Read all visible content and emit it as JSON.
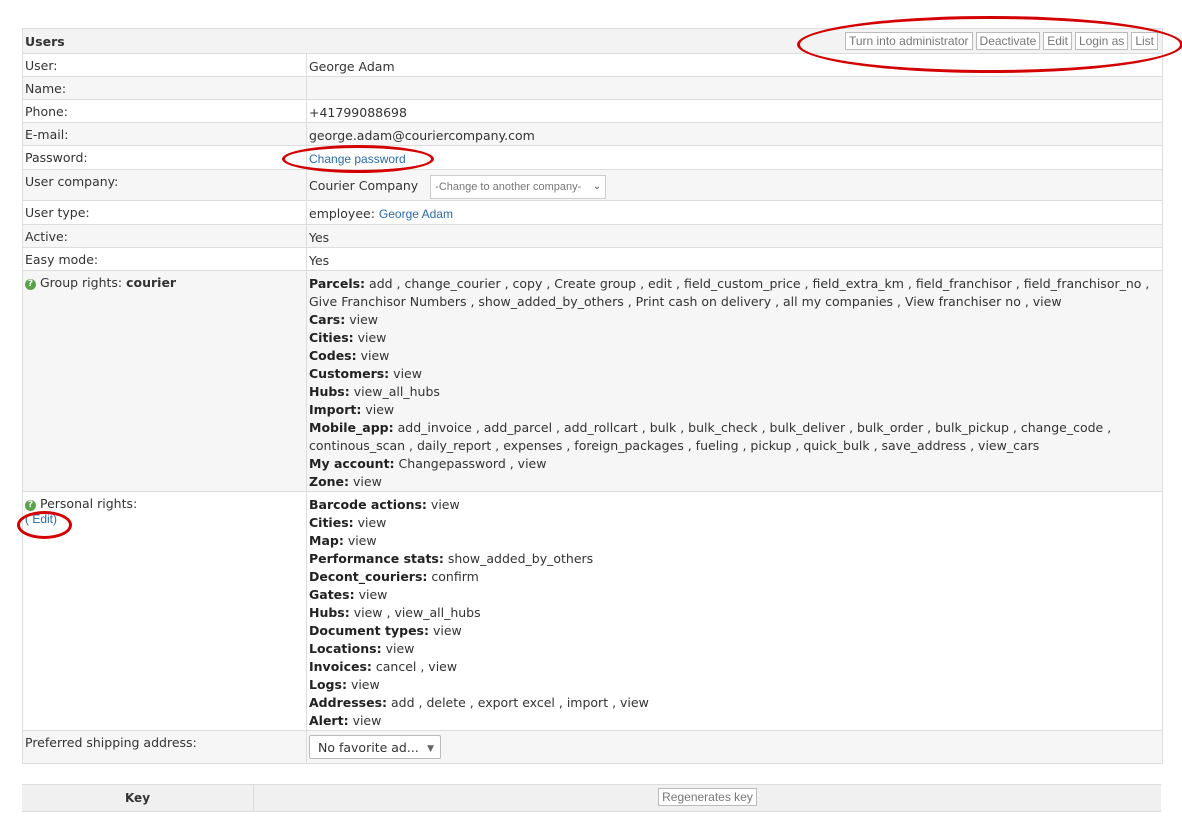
{
  "header": {
    "title": "Users",
    "buttons": [
      "Turn into administrator",
      "Deactivate",
      "Edit",
      "Login as",
      "List"
    ]
  },
  "fields": {
    "user": {
      "label": "User:",
      "value": "George Adam"
    },
    "name": {
      "label": "Name:",
      "value": ""
    },
    "phone": {
      "label": "Phone:",
      "value": "+41799088698"
    },
    "email": {
      "label": "E-mail:",
      "value": "george.adam@couriercompany.com"
    },
    "password": {
      "label": "Password:",
      "link": "Change password"
    },
    "company": {
      "label": "User company:",
      "value": "Courier Company",
      "select_placeholder": "-Change to another company-"
    },
    "user_type": {
      "label": "User type:",
      "prefix": "employee:",
      "link": "George Adam"
    },
    "active": {
      "label": "Active:",
      "value": "Yes"
    },
    "easy_mode": {
      "label": "Easy mode:",
      "value": "Yes"
    }
  },
  "group_rights": {
    "label": "Group rights:",
    "group": "courier",
    "perms": [
      {
        "name": "Parcels:",
        "values": "add , change_courier , copy , Create group , edit , field_custom_price , field_extra_km , field_franchisor , field_franchisor_no , Give Franchisor Numbers , show_added_by_others , Print cash on delivery , all my companies , View franchiser no , view"
      },
      {
        "name": "Cars:",
        "values": "view"
      },
      {
        "name": "Cities:",
        "values": "view"
      },
      {
        "name": "Codes:",
        "values": "view"
      },
      {
        "name": "Customers:",
        "values": "view"
      },
      {
        "name": "Hubs:",
        "values": "view_all_hubs"
      },
      {
        "name": "Import:",
        "values": "view"
      },
      {
        "name": "Mobile_app:",
        "values": "add_invoice , add_parcel , add_rollcart , bulk , bulk_check , bulk_deliver , bulk_order , bulk_pickup , change_code , continous_scan , daily_report , expenses , foreign_packages , fueling , pickup , quick_bulk , save_address , view_cars"
      },
      {
        "name": "My account:",
        "values": "Changepassword , view"
      },
      {
        "name": "Zone:",
        "values": "view"
      }
    ]
  },
  "personal_rights": {
    "label": "Personal rights:",
    "edit_link": "( Edit)",
    "perms": [
      {
        "name": "Barcode actions:",
        "values": "view"
      },
      {
        "name": "Cities:",
        "values": "view"
      },
      {
        "name": "Map:",
        "values": "view"
      },
      {
        "name": "Performance stats:",
        "values": "show_added_by_others"
      },
      {
        "name": "Decont_couriers:",
        "values": "confirm"
      },
      {
        "name": "Gates:",
        "values": "view"
      },
      {
        "name": "Hubs:",
        "values": "view , view_all_hubs"
      },
      {
        "name": "Document types:",
        "values": "view"
      },
      {
        "name": "Locations:",
        "values": "view"
      },
      {
        "name": "Invoices:",
        "values": "cancel , view"
      },
      {
        "name": "Logs:",
        "values": "view"
      },
      {
        "name": "Addresses:",
        "values": "add , delete , export excel , import , view"
      },
      {
        "name": "Alert:",
        "values": "view"
      }
    ]
  },
  "shipping": {
    "label": "Preferred shipping address:",
    "value": "No favorite ad..."
  },
  "keys": {
    "column_label": "Key",
    "button": "Regenerates key"
  },
  "colors": {
    "annotation": "#d40000",
    "link": "#2a6aa8",
    "help_icon": "#5aa34a"
  }
}
